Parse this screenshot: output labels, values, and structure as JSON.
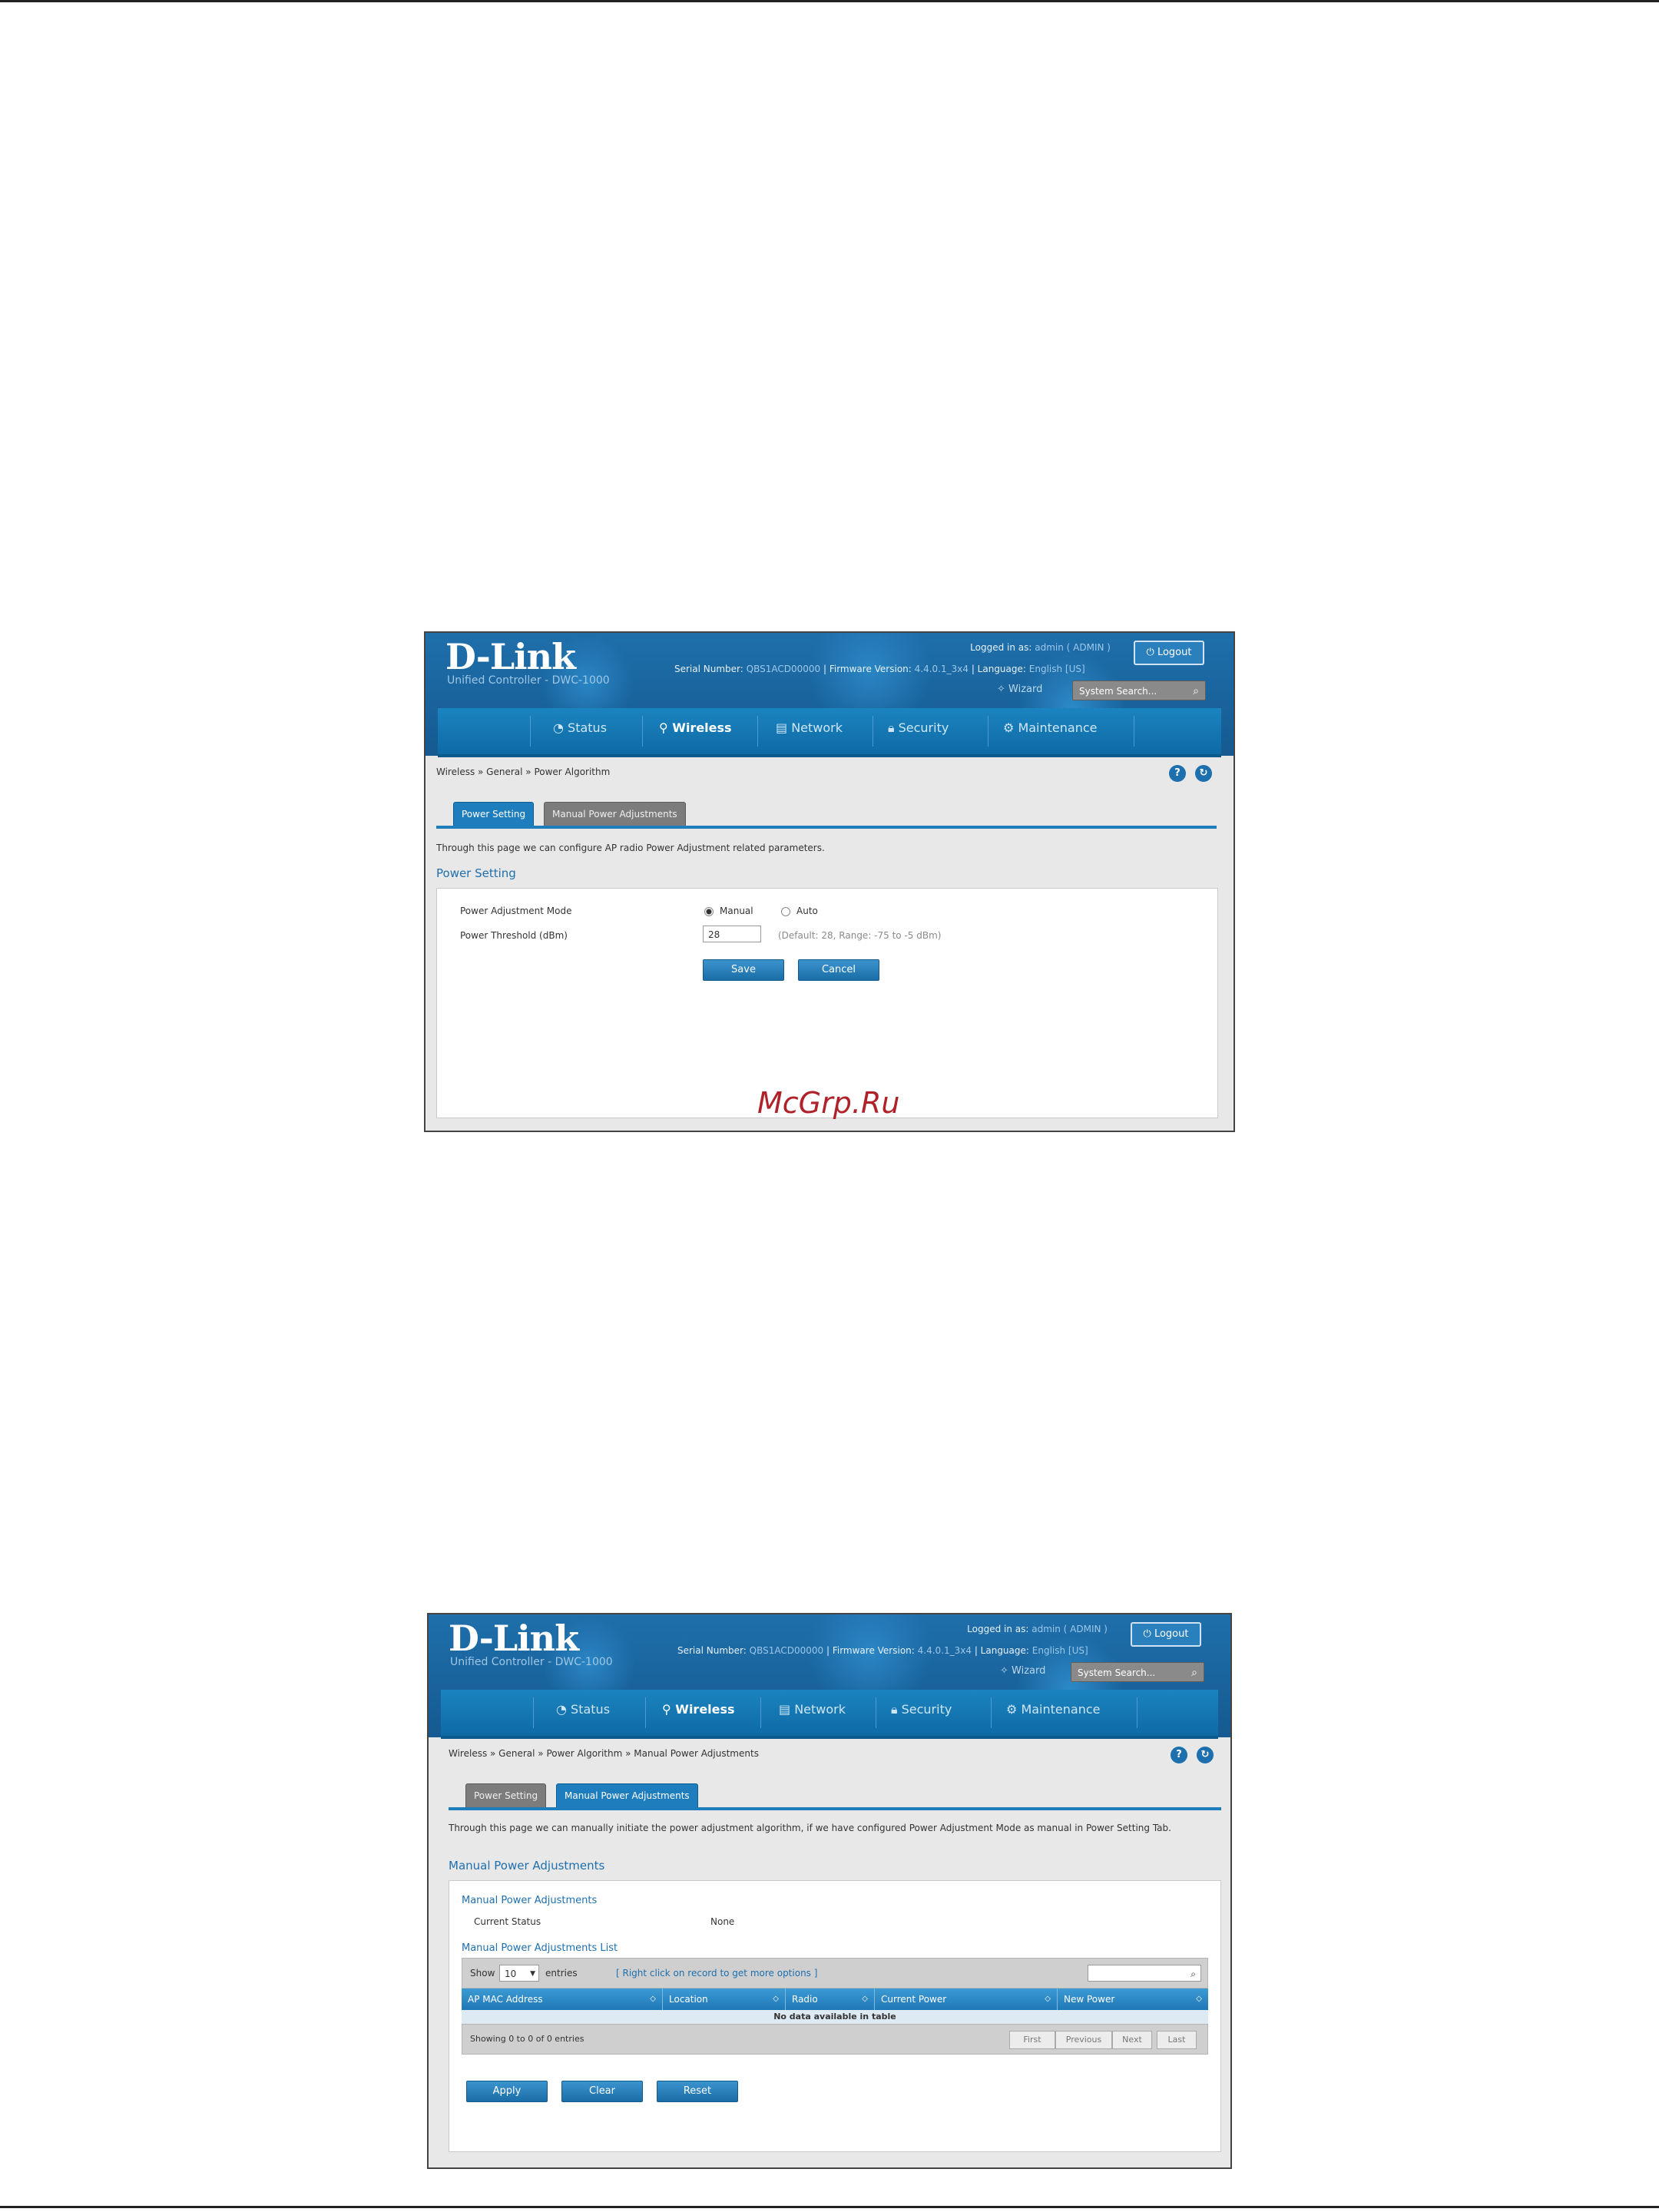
{
  "watermark": "McGrp.Ru",
  "common": {
    "brand": "D-Link",
    "product": "Unified Controller - DWC-1000",
    "logged_in_label": "Logged in as:",
    "logged_in_user": "admin ( ADMIN )",
    "logout_label": "Logout",
    "serial_label": "Serial Number:",
    "serial_value": "QBS1ACD00000",
    "firmware_label": "Firmware Version:",
    "firmware_value": "4.4.0.1_3x4",
    "language_label": "Language:",
    "language_value": "English [US]",
    "wizard_label": "Wizard",
    "search_label": "System Search...",
    "nav": [
      "Status",
      "Wireless",
      "Network",
      "Security",
      "Maintenance"
    ],
    "active_nav": "Wireless"
  },
  "screen1": {
    "breadcrumb": "Wireless  »  General  »  Power Algorithm",
    "tabs": [
      "Power Setting",
      "Manual Power Adjustments"
    ],
    "description": "Through this page we can configure AP radio Power Adjustment related parameters.",
    "section_title": "Power Setting",
    "fields": {
      "mode_label": "Power Adjustment Mode",
      "mode_options": [
        "Manual",
        "Auto"
      ],
      "mode_selected": "Manual",
      "threshold_label": "Power Threshold (dBm)",
      "threshold_value": "28",
      "threshold_hint": "(Default: 28, Range: -75 to -5 dBm)"
    },
    "buttons": {
      "save": "Save",
      "cancel": "Cancel"
    }
  },
  "screen2": {
    "breadcrumb": "Wireless  »  General  »  Power Algorithm  »  Manual Power Adjustments",
    "tabs": [
      "Power Setting",
      "Manual Power Adjustments"
    ],
    "description": "Through this page we can manually initiate the power adjustment algorithm, if we have configured Power Adjustment Mode as manual in Power Setting Tab.",
    "section_title": "Manual Power Adjustments",
    "status_head": "Manual Power Adjustments",
    "status_label": "Current Status",
    "status_value": "None",
    "list_head": "Manual Power Adjustments List",
    "show_label": "Show",
    "show_value": "10",
    "entries_label": "entries",
    "right_click_hint": "[ Right click on record to get more options ]",
    "columns": [
      "AP MAC Address",
      "Location",
      "Radio",
      "Current Power",
      "New Power"
    ],
    "empty_text": "No data available in table",
    "showing_text": "Showing 0 to 0 of 0 entries",
    "pagination": [
      "First",
      "Previous",
      "Next",
      "Last"
    ],
    "buttons": {
      "apply": "Apply",
      "clear": "Clear",
      "reset": "Reset"
    }
  },
  "colors": {
    "brand_blue": "#1e6fae",
    "header_blue": "#155a91",
    "tab_active": "#1e7dbd",
    "tab_inactive": "#7c7c7c"
  }
}
